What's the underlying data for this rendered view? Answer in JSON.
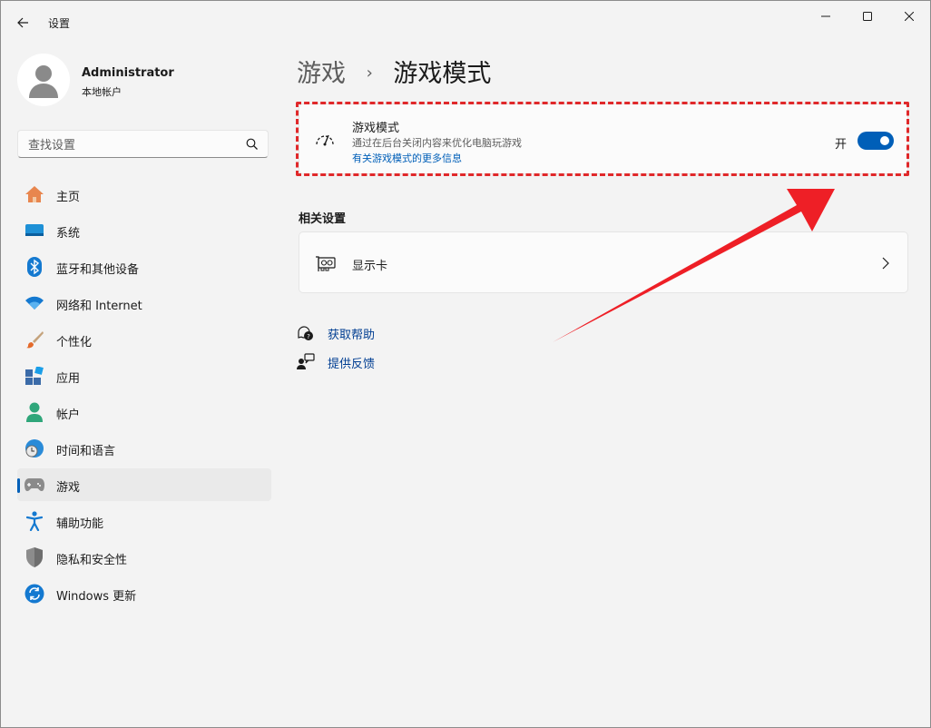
{
  "app": {
    "title": "设置"
  },
  "profile": {
    "name": "Administrator",
    "subtitle": "本地帐户"
  },
  "search": {
    "placeholder": "查找设置"
  },
  "sidebar": {
    "items": [
      {
        "label": "主页",
        "icon": "home-icon"
      },
      {
        "label": "系统",
        "icon": "system-icon"
      },
      {
        "label": "蓝牙和其他设备",
        "icon": "bluetooth-icon"
      },
      {
        "label": "网络和 Internet",
        "icon": "wifi-icon"
      },
      {
        "label": "个性化",
        "icon": "brush-icon"
      },
      {
        "label": "应用",
        "icon": "apps-icon"
      },
      {
        "label": "帐户",
        "icon": "account-icon"
      },
      {
        "label": "时间和语言",
        "icon": "clock-globe-icon"
      },
      {
        "label": "游戏",
        "icon": "gamepad-icon",
        "selected": true
      },
      {
        "label": "辅助功能",
        "icon": "accessibility-icon"
      },
      {
        "label": "隐私和安全性",
        "icon": "shield-icon"
      },
      {
        "label": "Windows 更新",
        "icon": "update-icon"
      }
    ]
  },
  "breadcrumb": {
    "parent": "游戏",
    "separator": "›",
    "current": "游戏模式"
  },
  "game_mode": {
    "title": "游戏模式",
    "description": "通过在后台关闭内容来优化电脑玩游戏",
    "link": "有关游戏模式的更多信息",
    "toggle_state_label": "开",
    "toggle_on": true
  },
  "related": {
    "title": "相关设置",
    "items": [
      {
        "label": "显示卡"
      }
    ]
  },
  "help_links": {
    "get_help": "获取帮助",
    "feedback": "提供反馈"
  },
  "colors": {
    "accent": "#005fb8",
    "highlight": "#e0282a"
  }
}
